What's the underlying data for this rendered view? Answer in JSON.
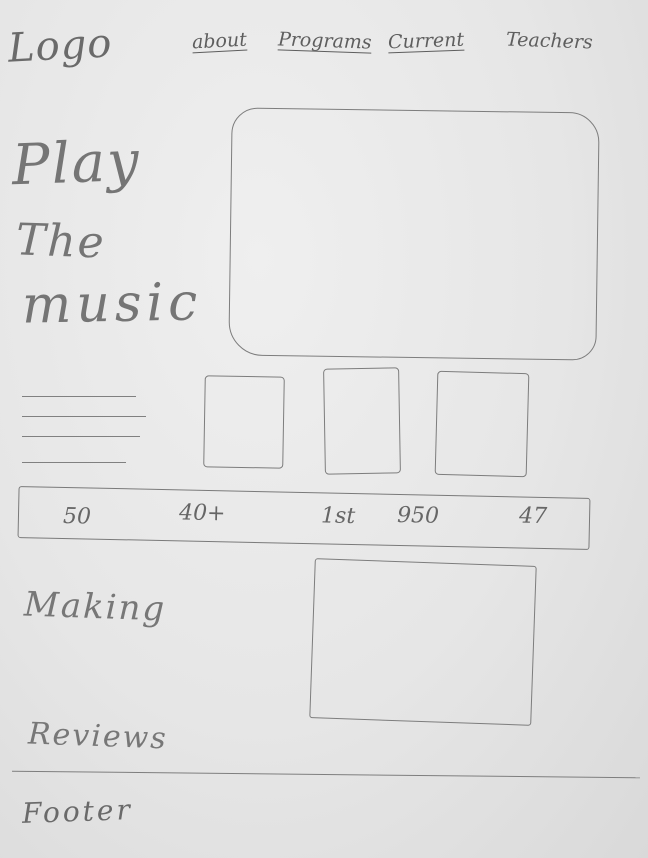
{
  "header": {
    "logo": "Logo",
    "nav": [
      "about",
      "Programs",
      "Current",
      "Teachers"
    ]
  },
  "hero": {
    "lines": [
      "Play",
      "The",
      "music"
    ]
  },
  "stats": [
    "50",
    "40+",
    "1st",
    "950",
    "47"
  ],
  "sections": {
    "feature_title": "Making",
    "reviews_title": "Reviews"
  },
  "footer": {
    "label": "Footer"
  }
}
